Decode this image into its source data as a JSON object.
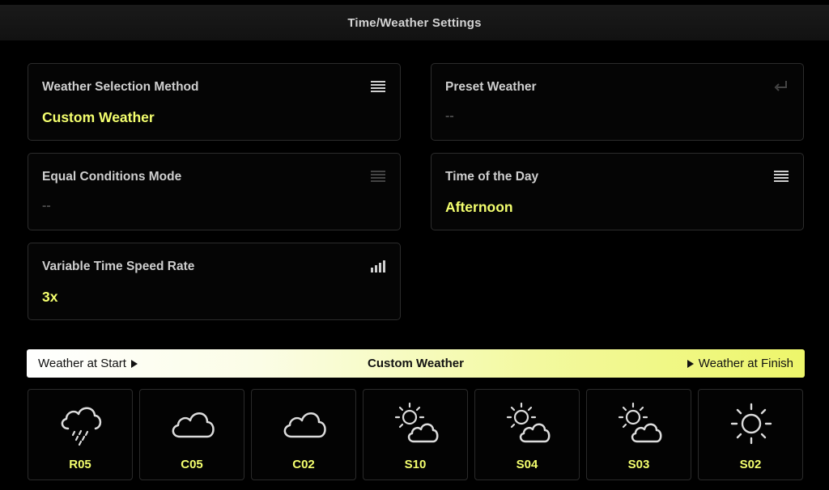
{
  "header": {
    "title": "Time/Weather Settings"
  },
  "settings": [
    {
      "label": "Weather Selection Method",
      "value": "Custom Weather",
      "icon": "list-icon",
      "enabled": true
    },
    {
      "label": "Preset Weather",
      "value": "--",
      "icon": "return-icon",
      "enabled": false
    },
    {
      "label": "Equal Conditions Mode",
      "value": "--",
      "icon": "list-icon",
      "enabled": false
    },
    {
      "label": "Time of the Day",
      "value": "Afternoon",
      "icon": "list-icon",
      "enabled": true
    },
    {
      "label": "Variable Time Speed Rate",
      "value": "3x",
      "icon": "signal-bars-icon",
      "enabled": true
    }
  ],
  "timeline": {
    "start_label": "Weather at Start",
    "center_label": "Custom Weather",
    "finish_label": "Weather at Finish"
  },
  "weather_slots": [
    {
      "code": "R05",
      "icon": "rain-cloud-icon"
    },
    {
      "code": "C05",
      "icon": "cloud-icon"
    },
    {
      "code": "C02",
      "icon": "cloud-icon"
    },
    {
      "code": "S10",
      "icon": "sun-behind-cloud-icon"
    },
    {
      "code": "S04",
      "icon": "sun-behind-cloud-icon"
    },
    {
      "code": "S03",
      "icon": "sun-behind-cloud-icon"
    },
    {
      "code": "S02",
      "icon": "sun-icon"
    }
  ],
  "colors": {
    "accent": "#f4ff6e",
    "disabled_value": "#4a4a4a",
    "card_border": "#2c2c2c"
  }
}
